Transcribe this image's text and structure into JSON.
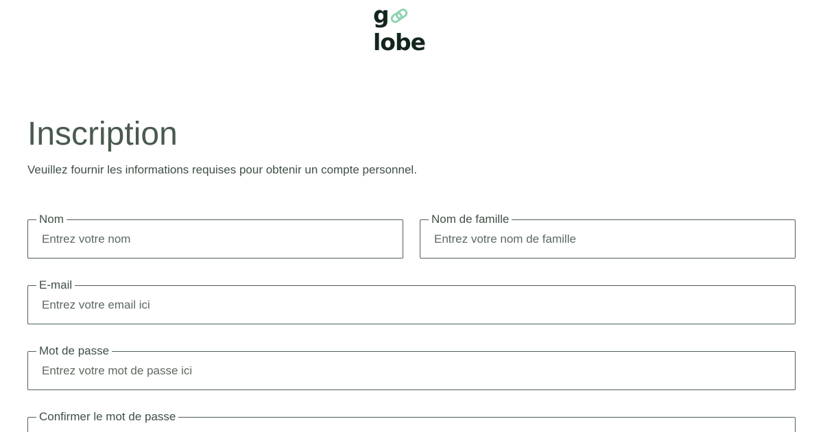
{
  "brand": {
    "logo_text_start": "g",
    "logo_text_end": "lobe",
    "logo_name": "globe-logo",
    "colors": {
      "logo_dark": "#13261c",
      "logo_accent": "#8fd3b1"
    }
  },
  "page": {
    "title": "Inscription",
    "subtitle": "Veuillez fournir les informations requises pour obtenir un compte personnel."
  },
  "form": {
    "first_name": {
      "label": "Nom",
      "placeholder": "Entrez votre nom",
      "value": ""
    },
    "last_name": {
      "label": "Nom de famille",
      "placeholder": "Entrez votre nom de famille",
      "value": ""
    },
    "email": {
      "label": "E-mail",
      "placeholder": "Entrez votre email ici",
      "value": ""
    },
    "password": {
      "label": "Mot de passe",
      "placeholder": "Entrez votre mot de passe ici",
      "value": ""
    },
    "confirm_password": {
      "label": "Confirmer le mot de passe",
      "placeholder": "",
      "value": ""
    }
  },
  "theme": {
    "text": "#3f4f45",
    "title": "#4a5a4f",
    "border": "#4f5e54",
    "background": "#ffffff"
  }
}
